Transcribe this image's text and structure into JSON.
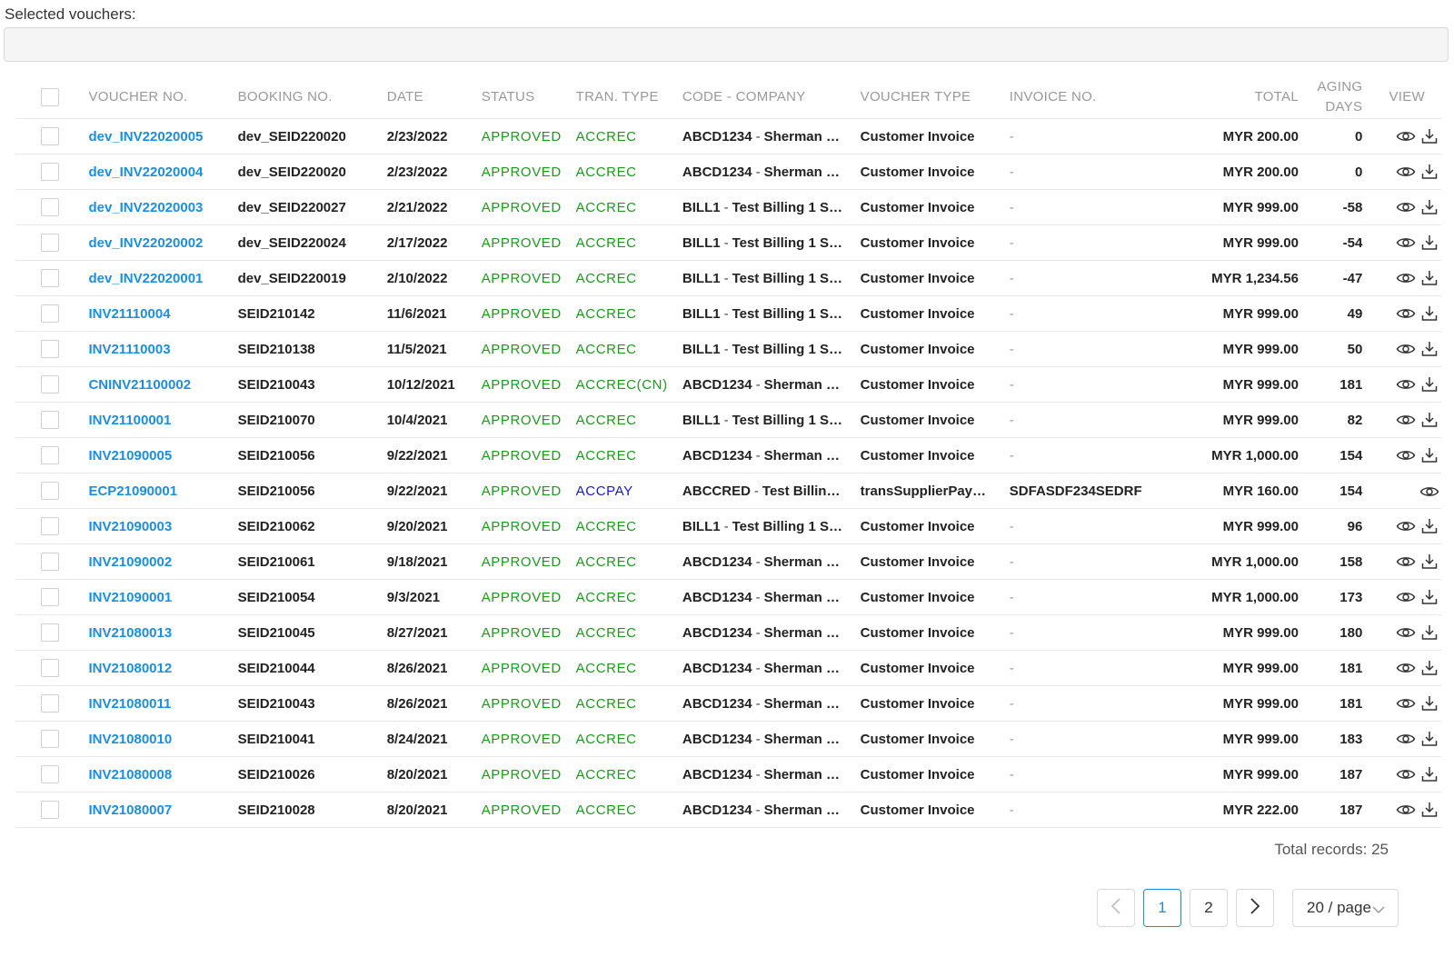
{
  "selected": {
    "label": "Selected vouchers:"
  },
  "columns": {
    "voucher_no": "VOUCHER NO.",
    "booking_no": "BOOKING NO.",
    "date": "DATE",
    "status": "STATUS",
    "tran_type": "TRAN. TYPE",
    "code_company": "CODE - COMPANY",
    "voucher_type": "VOUCHER TYPE",
    "invoice_no": "INVOICE NO.",
    "total": "TOTAL",
    "aging_1": "AGING",
    "aging_2": "DAYS",
    "view": "VIEW"
  },
  "rows": [
    {
      "voucher": "dev_INV22020005",
      "booking": "dev_SEID220020",
      "date": "2/23/2022",
      "status": "APPROVED",
      "tran": "ACCREC",
      "code": "ABCD1234",
      "company": "Sherman …",
      "vtype": "Customer Invoice",
      "invoice": "-",
      "total": "MYR 200.00",
      "aging": "0",
      "download": true
    },
    {
      "voucher": "dev_INV22020004",
      "booking": "dev_SEID220020",
      "date": "2/23/2022",
      "status": "APPROVED",
      "tran": "ACCREC",
      "code": "ABCD1234",
      "company": "Sherman …",
      "vtype": "Customer Invoice",
      "invoice": "-",
      "total": "MYR 200.00",
      "aging": "0",
      "download": true
    },
    {
      "voucher": "dev_INV22020003",
      "booking": "dev_SEID220027",
      "date": "2/21/2022",
      "status": "APPROVED",
      "tran": "ACCREC",
      "code": "BILL1",
      "company": "Test Billing 1 S…",
      "vtype": "Customer Invoice",
      "invoice": "-",
      "total": "MYR 999.00",
      "aging": "-58",
      "download": true
    },
    {
      "voucher": "dev_INV22020002",
      "booking": "dev_SEID220024",
      "date": "2/17/2022",
      "status": "APPROVED",
      "tran": "ACCREC",
      "code": "BILL1",
      "company": "Test Billing 1 S…",
      "vtype": "Customer Invoice",
      "invoice": "-",
      "total": "MYR 999.00",
      "aging": "-54",
      "download": true
    },
    {
      "voucher": "dev_INV22020001",
      "booking": "dev_SEID220019",
      "date": "2/10/2022",
      "status": "APPROVED",
      "tran": "ACCREC",
      "code": "BILL1",
      "company": "Test Billing 1 S…",
      "vtype": "Customer Invoice",
      "invoice": "-",
      "total": "MYR 1,234.56",
      "aging": "-47",
      "download": true
    },
    {
      "voucher": "INV21110004",
      "booking": "SEID210142",
      "date": "11/6/2021",
      "status": "APPROVED",
      "tran": "ACCREC",
      "code": "BILL1",
      "company": "Test Billing 1 S…",
      "vtype": "Customer Invoice",
      "invoice": "-",
      "total": "MYR 999.00",
      "aging": "49",
      "download": true
    },
    {
      "voucher": "INV21110003",
      "booking": "SEID210138",
      "date": "11/5/2021",
      "status": "APPROVED",
      "tran": "ACCREC",
      "code": "BILL1",
      "company": "Test Billing 1 S…",
      "vtype": "Customer Invoice",
      "invoice": "-",
      "total": "MYR 999.00",
      "aging": "50",
      "download": true
    },
    {
      "voucher": "CNINV21100002",
      "booking": "SEID210043",
      "date": "10/12/2021",
      "status": "APPROVED",
      "tran": "ACCREC(CN)",
      "code": "ABCD1234",
      "company": "Sherman …",
      "vtype": "Customer Invoice",
      "invoice": "-",
      "total": "MYR 999.00",
      "aging": "181",
      "download": true
    },
    {
      "voucher": "INV21100001",
      "booking": "SEID210070",
      "date": "10/4/2021",
      "status": "APPROVED",
      "tran": "ACCREC",
      "code": "BILL1",
      "company": "Test Billing 1 S…",
      "vtype": "Customer Invoice",
      "invoice": "-",
      "total": "MYR 999.00",
      "aging": "82",
      "download": true
    },
    {
      "voucher": "INV21090005",
      "booking": "SEID210056",
      "date": "9/22/2021",
      "status": "APPROVED",
      "tran": "ACCREC",
      "code": "ABCD1234",
      "company": "Sherman …",
      "vtype": "Customer Invoice",
      "invoice": "-",
      "total": "MYR 1,000.00",
      "aging": "154",
      "download": true
    },
    {
      "voucher": "ECP21090001",
      "booking": "SEID210056",
      "date": "9/22/2021",
      "status": "APPROVED",
      "tran": "ACCPAY",
      "code": "ABCCRED",
      "company": "Test Billin…",
      "vtype": "transSupplierPay…",
      "invoice": "SDFASDF234SEDRF",
      "total": "MYR 160.00",
      "aging": "154",
      "download": false
    },
    {
      "voucher": "INV21090003",
      "booking": "SEID210062",
      "date": "9/20/2021",
      "status": "APPROVED",
      "tran": "ACCREC",
      "code": "BILL1",
      "company": "Test Billing 1 S…",
      "vtype": "Customer Invoice",
      "invoice": "-",
      "total": "MYR 999.00",
      "aging": "96",
      "download": true
    },
    {
      "voucher": "INV21090002",
      "booking": "SEID210061",
      "date": "9/18/2021",
      "status": "APPROVED",
      "tran": "ACCREC",
      "code": "ABCD1234",
      "company": "Sherman …",
      "vtype": "Customer Invoice",
      "invoice": "-",
      "total": "MYR 1,000.00",
      "aging": "158",
      "download": true
    },
    {
      "voucher": "INV21090001",
      "booking": "SEID210054",
      "date": "9/3/2021",
      "status": "APPROVED",
      "tran": "ACCREC",
      "code": "ABCD1234",
      "company": "Sherman …",
      "vtype": "Customer Invoice",
      "invoice": "-",
      "total": "MYR 1,000.00",
      "aging": "173",
      "download": true
    },
    {
      "voucher": "INV21080013",
      "booking": "SEID210045",
      "date": "8/27/2021",
      "status": "APPROVED",
      "tran": "ACCREC",
      "code": "ABCD1234",
      "company": "Sherman …",
      "vtype": "Customer Invoice",
      "invoice": "-",
      "total": "MYR 999.00",
      "aging": "180",
      "download": true
    },
    {
      "voucher": "INV21080012",
      "booking": "SEID210044",
      "date": "8/26/2021",
      "status": "APPROVED",
      "tran": "ACCREC",
      "code": "ABCD1234",
      "company": "Sherman …",
      "vtype": "Customer Invoice",
      "invoice": "-",
      "total": "MYR 999.00",
      "aging": "181",
      "download": true
    },
    {
      "voucher": "INV21080011",
      "booking": "SEID210043",
      "date": "8/26/2021",
      "status": "APPROVED",
      "tran": "ACCREC",
      "code": "ABCD1234",
      "company": "Sherman …",
      "vtype": "Customer Invoice",
      "invoice": "-",
      "total": "MYR 999.00",
      "aging": "181",
      "download": true
    },
    {
      "voucher": "INV21080010",
      "booking": "SEID210041",
      "date": "8/24/2021",
      "status": "APPROVED",
      "tran": "ACCREC",
      "code": "ABCD1234",
      "company": "Sherman …",
      "vtype": "Customer Invoice",
      "invoice": "-",
      "total": "MYR 999.00",
      "aging": "183",
      "download": true
    },
    {
      "voucher": "INV21080008",
      "booking": "SEID210026",
      "date": "8/20/2021",
      "status": "APPROVED",
      "tran": "ACCREC",
      "code": "ABCD1234",
      "company": "Sherman …",
      "vtype": "Customer Invoice",
      "invoice": "-",
      "total": "MYR 999.00",
      "aging": "187",
      "download": true
    },
    {
      "voucher": "INV21080007",
      "booking": "SEID210028",
      "date": "8/20/2021",
      "status": "APPROVED",
      "tran": "ACCREC",
      "code": "ABCD1234",
      "company": "Sherman …",
      "vtype": "Customer Invoice",
      "invoice": "-",
      "total": "MYR 222.00",
      "aging": "187",
      "download": true
    }
  ],
  "footer": {
    "total_records": "Total records: 25",
    "pages": [
      "1",
      "2"
    ],
    "current_page": "1",
    "page_size": "20 / page"
  },
  "colors": {
    "link": "#1a8fe0",
    "status_green": "#1a9b1a",
    "accpay_blue": "#1616d8",
    "border": "#e8e8e8"
  },
  "icons": {
    "view": "eye-icon",
    "download": "download-icon",
    "prev": "chevron-left-icon",
    "next": "chevron-right-icon",
    "dropdown": "chevron-down-icon"
  }
}
